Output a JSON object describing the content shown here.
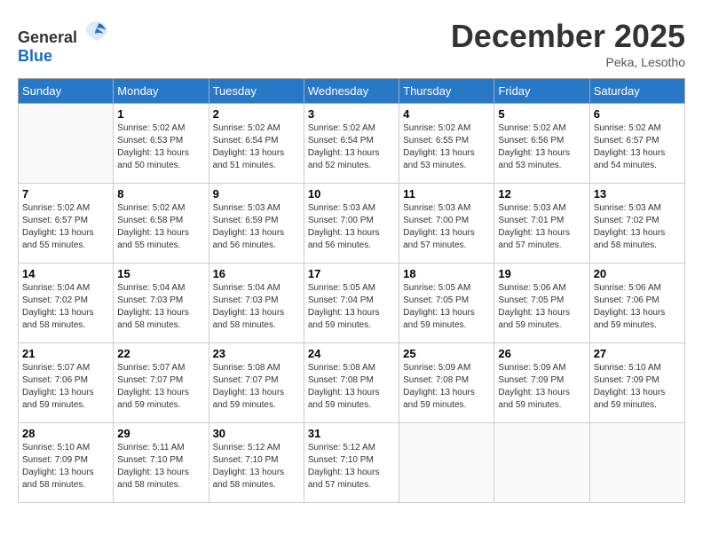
{
  "header": {
    "logo_general": "General",
    "logo_blue": "Blue",
    "month_title": "December 2025",
    "location": "Peka, Lesotho"
  },
  "weekdays": [
    "Sunday",
    "Monday",
    "Tuesday",
    "Wednesday",
    "Thursday",
    "Friday",
    "Saturday"
  ],
  "weeks": [
    [
      {
        "day": "",
        "info": ""
      },
      {
        "day": "1",
        "info": "Sunrise: 5:02 AM\nSunset: 6:53 PM\nDaylight: 13 hours\nand 50 minutes."
      },
      {
        "day": "2",
        "info": "Sunrise: 5:02 AM\nSunset: 6:54 PM\nDaylight: 13 hours\nand 51 minutes."
      },
      {
        "day": "3",
        "info": "Sunrise: 5:02 AM\nSunset: 6:54 PM\nDaylight: 13 hours\nand 52 minutes."
      },
      {
        "day": "4",
        "info": "Sunrise: 5:02 AM\nSunset: 6:55 PM\nDaylight: 13 hours\nand 53 minutes."
      },
      {
        "day": "5",
        "info": "Sunrise: 5:02 AM\nSunset: 6:56 PM\nDaylight: 13 hours\nand 53 minutes."
      },
      {
        "day": "6",
        "info": "Sunrise: 5:02 AM\nSunset: 6:57 PM\nDaylight: 13 hours\nand 54 minutes."
      }
    ],
    [
      {
        "day": "7",
        "info": "Sunrise: 5:02 AM\nSunset: 6:57 PM\nDaylight: 13 hours\nand 55 minutes."
      },
      {
        "day": "8",
        "info": "Sunrise: 5:02 AM\nSunset: 6:58 PM\nDaylight: 13 hours\nand 55 minutes."
      },
      {
        "day": "9",
        "info": "Sunrise: 5:03 AM\nSunset: 6:59 PM\nDaylight: 13 hours\nand 56 minutes."
      },
      {
        "day": "10",
        "info": "Sunrise: 5:03 AM\nSunset: 7:00 PM\nDaylight: 13 hours\nand 56 minutes."
      },
      {
        "day": "11",
        "info": "Sunrise: 5:03 AM\nSunset: 7:00 PM\nDaylight: 13 hours\nand 57 minutes."
      },
      {
        "day": "12",
        "info": "Sunrise: 5:03 AM\nSunset: 7:01 PM\nDaylight: 13 hours\nand 57 minutes."
      },
      {
        "day": "13",
        "info": "Sunrise: 5:03 AM\nSunset: 7:02 PM\nDaylight: 13 hours\nand 58 minutes."
      }
    ],
    [
      {
        "day": "14",
        "info": "Sunrise: 5:04 AM\nSunset: 7:02 PM\nDaylight: 13 hours\nand 58 minutes."
      },
      {
        "day": "15",
        "info": "Sunrise: 5:04 AM\nSunset: 7:03 PM\nDaylight: 13 hours\nand 58 minutes."
      },
      {
        "day": "16",
        "info": "Sunrise: 5:04 AM\nSunset: 7:03 PM\nDaylight: 13 hours\nand 58 minutes."
      },
      {
        "day": "17",
        "info": "Sunrise: 5:05 AM\nSunset: 7:04 PM\nDaylight: 13 hours\nand 59 minutes."
      },
      {
        "day": "18",
        "info": "Sunrise: 5:05 AM\nSunset: 7:05 PM\nDaylight: 13 hours\nand 59 minutes."
      },
      {
        "day": "19",
        "info": "Sunrise: 5:06 AM\nSunset: 7:05 PM\nDaylight: 13 hours\nand 59 minutes."
      },
      {
        "day": "20",
        "info": "Sunrise: 5:06 AM\nSunset: 7:06 PM\nDaylight: 13 hours\nand 59 minutes."
      }
    ],
    [
      {
        "day": "21",
        "info": "Sunrise: 5:07 AM\nSunset: 7:06 PM\nDaylight: 13 hours\nand 59 minutes."
      },
      {
        "day": "22",
        "info": "Sunrise: 5:07 AM\nSunset: 7:07 PM\nDaylight: 13 hours\nand 59 minutes."
      },
      {
        "day": "23",
        "info": "Sunrise: 5:08 AM\nSunset: 7:07 PM\nDaylight: 13 hours\nand 59 minutes."
      },
      {
        "day": "24",
        "info": "Sunrise: 5:08 AM\nSunset: 7:08 PM\nDaylight: 13 hours\nand 59 minutes."
      },
      {
        "day": "25",
        "info": "Sunrise: 5:09 AM\nSunset: 7:08 PM\nDaylight: 13 hours\nand 59 minutes."
      },
      {
        "day": "26",
        "info": "Sunrise: 5:09 AM\nSunset: 7:09 PM\nDaylight: 13 hours\nand 59 minutes."
      },
      {
        "day": "27",
        "info": "Sunrise: 5:10 AM\nSunset: 7:09 PM\nDaylight: 13 hours\nand 59 minutes."
      }
    ],
    [
      {
        "day": "28",
        "info": "Sunrise: 5:10 AM\nSunset: 7:09 PM\nDaylight: 13 hours\nand 58 minutes."
      },
      {
        "day": "29",
        "info": "Sunrise: 5:11 AM\nSunset: 7:10 PM\nDaylight: 13 hours\nand 58 minutes."
      },
      {
        "day": "30",
        "info": "Sunrise: 5:12 AM\nSunset: 7:10 PM\nDaylight: 13 hours\nand 58 minutes."
      },
      {
        "day": "31",
        "info": "Sunrise: 5:12 AM\nSunset: 7:10 PM\nDaylight: 13 hours\nand 57 minutes."
      },
      {
        "day": "",
        "info": ""
      },
      {
        "day": "",
        "info": ""
      },
      {
        "day": "",
        "info": ""
      }
    ]
  ]
}
